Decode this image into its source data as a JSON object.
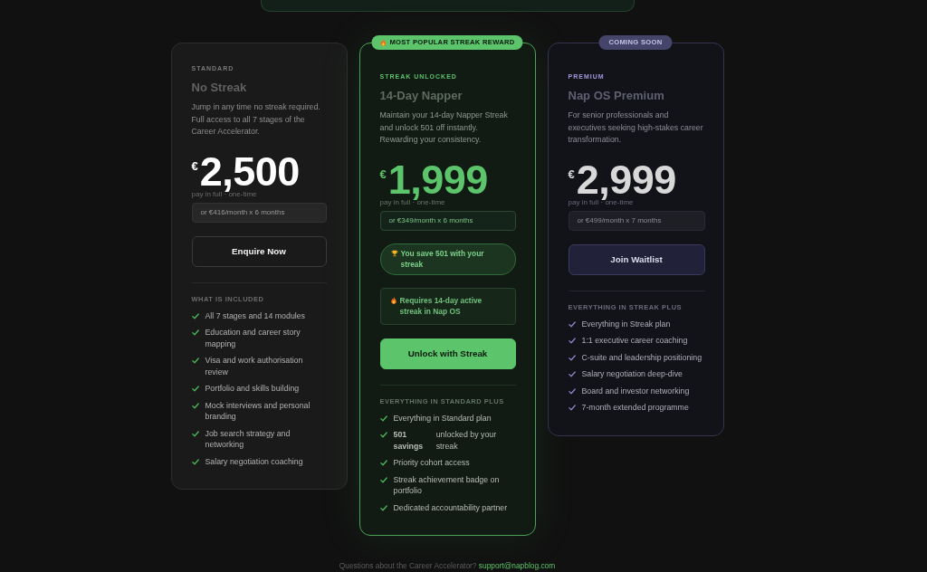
{
  "plans": [
    {
      "kind": "standard",
      "tier": "STANDARD",
      "name": "No Streak",
      "description": "Jump in any time no streak required. Full access to all 7 stages of the Career Accelerator.",
      "currency": "€",
      "price": "2,500",
      "payment_note": "pay in full · one-time",
      "installments": "or €416/month x 6 months",
      "button": "Enquire Now",
      "features_heading": "WHAT IS INCLUDED",
      "features": [
        "All 7 stages and 14 modules",
        "Education and career story mapping",
        "Visa and work authorisation review",
        "Portfolio and skills building",
        "Mock interviews and personal branding",
        "Job search strategy and networking",
        "Salary negotiation coaching"
      ]
    },
    {
      "kind": "streak",
      "badge": {
        "kind": "popular",
        "text": "MOST POPULAR STREAK REWARD"
      },
      "tier": "STREAK UNLOCKED",
      "name": "14-Day Napper",
      "description": "Maintain your 14-day Napper Streak and unlock 501 off instantly. Rewarding your consistency.",
      "currency": "€",
      "price": "1,999",
      "payment_note": "pay in full · one-time",
      "installments": "or €349/month x 6 months",
      "notes": [
        {
          "kind": "savings",
          "text": "You save 501 with your streak"
        },
        {
          "kind": "requirement",
          "text": "Requires 14-day active streak in Nap OS"
        }
      ],
      "button": "Unlock with Streak",
      "features_heading": "EVERYTHING IN STANDARD PLUS",
      "features": [
        "Everything in Standard plan",
        "**501 savings** unlocked by your streak",
        "Priority cohort access",
        "Streak achievement badge on portfolio",
        "Dedicated accountability partner"
      ]
    },
    {
      "kind": "premium",
      "badge": {
        "kind": "upcoming",
        "text": "COMING SOON"
      },
      "tier": "PREMIUM",
      "name": "Nap OS Premium",
      "description": "For senior professionals and executives seeking high-stakes career transformation.",
      "currency": "€",
      "price": "2,999",
      "payment_note": "pay in full · one-time",
      "installments": "or €499/month x 7 months",
      "button": "Join Waitlist",
      "features_heading": "EVERYTHING IN STREAK PLUS",
      "features": [
        "Everything in Streak plan",
        "1:1 executive career coaching",
        "C-suite and leadership positioning",
        "Salary negotiation deep-dive",
        "Board and investor networking",
        "7-month extended programme"
      ]
    }
  ],
  "footer": {
    "text": "Questions about the Career Accelerator?",
    "link": "support@napblog.com"
  }
}
